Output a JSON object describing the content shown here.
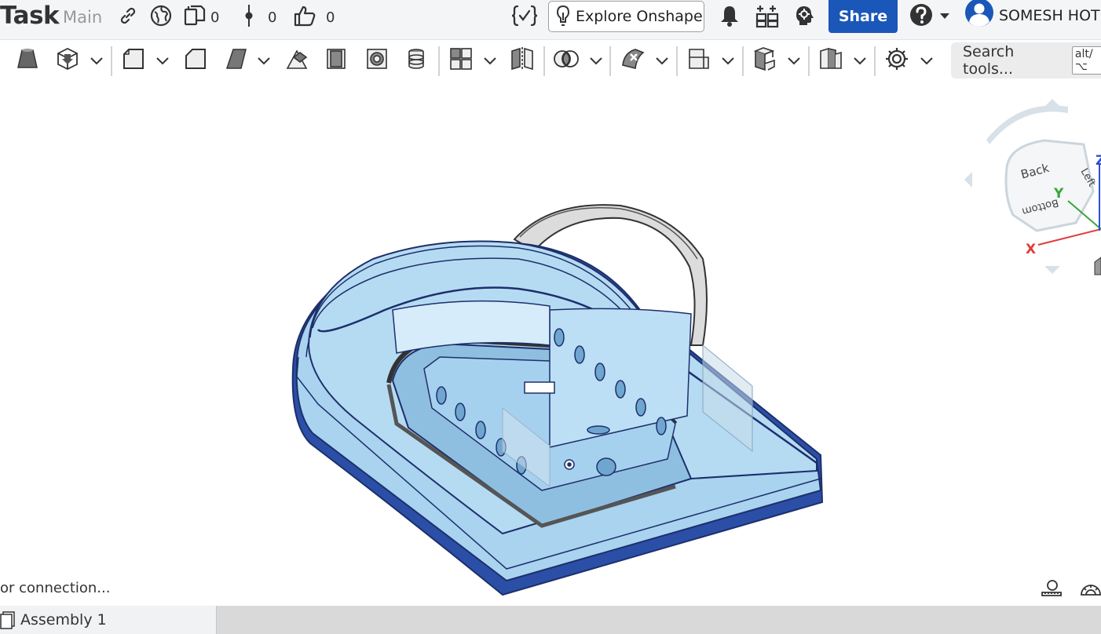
{
  "header": {
    "document_title": "Task",
    "branch": "Main",
    "counts": {
      "copies": "0",
      "versions": "0",
      "likes": "0"
    },
    "explore_label": "Explore Onshape",
    "share_label": "Share",
    "user_name": "SOMESH HOT",
    "icons": [
      "link-icon",
      "globe-icon",
      "copy-icon",
      "version-icon",
      "thumbs-up-icon",
      "variable-studio-icon",
      "lightbulb-icon",
      "bell-icon",
      "apps-icon",
      "learning-center-icon",
      "help-icon",
      "user-avatar-icon"
    ]
  },
  "toolbar": {
    "tools": [
      "insert-part-icon",
      "replicate-icon",
      "fastened-mate-icon",
      "slider-mate-icon",
      "revolute-mate-icon",
      "cylindrical-mate-icon",
      "planar-mate-icon",
      "ball-mate-icon",
      "parallel-mate-icon",
      "pattern-icon",
      "mirror-icon",
      "group-icon",
      "mate-connector-icon",
      "section-view-icon",
      "explode-icon",
      "bom-icon",
      "settings-icon"
    ],
    "search_placeholder": "Search tools...",
    "search_shortcut": "alt/⌥"
  },
  "view_cube": {
    "faces": {
      "back": "Back",
      "left": "Left",
      "bottom": "Bottom"
    },
    "axes": {
      "x": "X",
      "y": "Y",
      "z": "Z"
    },
    "colors": {
      "x": "#e03b3b",
      "y": "#3aa63a",
      "z": "#2c4fd6"
    }
  },
  "model": {
    "body_color": "#a9d3ef",
    "edge_color": "#1d2f6b",
    "base_stripe_color": "#2b4fa6",
    "strap_color": "#e8e8e8"
  },
  "status": {
    "text": "or connection..."
  },
  "tabs": [
    {
      "label": "Assembly 1",
      "active": true
    }
  ]
}
